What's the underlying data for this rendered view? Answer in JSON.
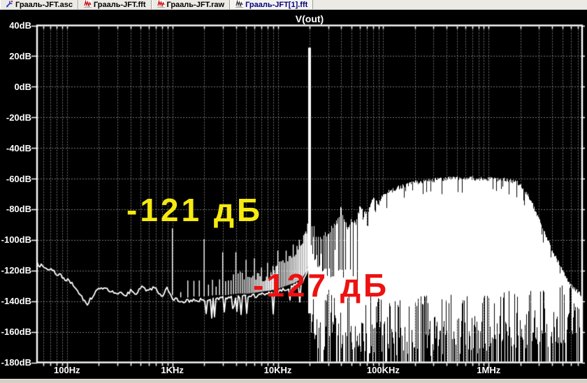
{
  "tabs": [
    {
      "label": "Грааль-JFT.asc",
      "icon": "schematic-icon",
      "active": false
    },
    {
      "label": "Грааль-JFT.fft",
      "icon": "waveform-icon",
      "active": false
    },
    {
      "label": "Грааль-JFT.raw",
      "icon": "waveform-icon",
      "active": false
    },
    {
      "label": "Грааль-JFT[1].fft",
      "icon": "waveform-gray-icon",
      "active": true
    }
  ],
  "plot": {
    "title": "V(out)",
    "y_axis": {
      "labels": [
        "40dB",
        "20dB",
        "0dB",
        "-20dB",
        "-40dB",
        "-60dB",
        "-80dB",
        "-100dB",
        "-120dB",
        "-140dB",
        "-160dB",
        "-180dB"
      ],
      "max_db": 40,
      "min_db": -180,
      "step_db": 20
    },
    "x_axis": {
      "labels": [
        {
          "text": "100Hz",
          "hz": 100
        },
        {
          "text": "1KHz",
          "hz": 1000
        },
        {
          "text": "10KHz",
          "hz": 10000
        },
        {
          "text": "100KHz",
          "hz": 100000
        },
        {
          "text": "1MHz",
          "hz": 1000000
        }
      ]
    }
  },
  "annotations": [
    {
      "text": "-121 дБ",
      "color": "#f6ea10"
    },
    {
      "text": "-127 дБ",
      "color": "#ed1111"
    }
  ],
  "colors": {
    "trace": "#ffffff",
    "grid": "#777777",
    "plot_bg": "#000000",
    "frame": "#ffffff",
    "tab_active_text": "#000080"
  },
  "chart_data": {
    "type": "line",
    "title": "V(out)",
    "x_unit": "Hz",
    "y_unit": "dB",
    "x_log": true,
    "x_range_hz": [
      52,
      7700000
    ],
    "y_range_db": [
      -180,
      40
    ],
    "grid_step_db": 20,
    "fundamental": {
      "freq_hz": 20000,
      "db": 25.5
    },
    "noise_floor": [
      [
        52,
        -115.5
      ],
      [
        66,
        -119
      ],
      [
        80,
        -122
      ],
      [
        95,
        -125
      ],
      [
        111,
        -128.5
      ],
      [
        130,
        -134
      ],
      [
        155,
        -142
      ],
      [
        181,
        -135
      ],
      [
        205,
        -131.5
      ],
      [
        228,
        -132
      ],
      [
        250,
        -132.5
      ],
      [
        276,
        -134.5
      ],
      [
        296,
        -135.5
      ],
      [
        324,
        -133.5
      ],
      [
        345,
        -135
      ],
      [
        366,
        -136
      ],
      [
        400,
        -133
      ],
      [
        430,
        -134
      ],
      [
        459,
        -134.5
      ],
      [
        490,
        -132
      ],
      [
        527,
        -130.5
      ],
      [
        560,
        -132.5
      ],
      [
        586,
        -134
      ],
      [
        620,
        -132
      ],
      [
        652,
        -131
      ],
      [
        690,
        -132
      ],
      [
        726,
        -133.5
      ],
      [
        770,
        -135
      ],
      [
        809,
        -137
      ],
      [
        850,
        -133
      ],
      [
        887,
        -130
      ],
      [
        940,
        -134
      ],
      [
        1000,
        -138
      ],
      [
        1100,
        -139
      ],
      [
        1300,
        -140
      ],
      [
        1600,
        -139
      ],
      [
        2000,
        -139
      ],
      [
        2600,
        -138
      ],
      [
        3300,
        -138
      ],
      [
        4200,
        -137
      ],
      [
        5300,
        -137
      ],
      [
        6700,
        -136
      ],
      [
        8500,
        -135
      ],
      [
        10000,
        -134
      ],
      [
        12000,
        -132
      ],
      [
        14500,
        -130
      ],
      [
        17000,
        -127
      ],
      [
        19000,
        -122
      ],
      [
        19800,
        -113
      ]
    ],
    "harmonic_peaks": [
      [
        1000,
        -92.5
      ],
      [
        2000,
        -99.5
      ],
      [
        3000,
        -108
      ],
      [
        4000,
        -108
      ],
      [
        5000,
        -113
      ],
      [
        6000,
        -112
      ],
      [
        7000,
        -118
      ],
      [
        8000,
        -115
      ],
      [
        9000,
        -117
      ],
      [
        10000,
        -107
      ],
      [
        11000,
        -108
      ],
      [
        12000,
        -107
      ],
      [
        13000,
        -105
      ],
      [
        14000,
        -103
      ],
      [
        15000,
        -102
      ],
      [
        16000,
        -100
      ],
      [
        17000,
        -98
      ],
      [
        18000,
        -96
      ],
      [
        19000,
        -90
      ]
    ],
    "sideband_envelope": [
      [
        1200,
        -133
      ],
      [
        1400,
        -126
      ],
      [
        1600,
        -127
      ],
      [
        1800,
        -128
      ],
      [
        2200,
        -127
      ],
      [
        2600,
        -129
      ],
      [
        3400,
        -124
      ],
      [
        4400,
        -123
      ],
      [
        5400,
        -125
      ],
      [
        6400,
        -124
      ],
      [
        7400,
        -126
      ],
      [
        8400,
        -122
      ],
      [
        9400,
        -121
      ],
      [
        10000,
        -117
      ],
      [
        12000,
        -113
      ],
      [
        14000,
        -110
      ],
      [
        16000,
        -104
      ],
      [
        18000,
        -98
      ],
      [
        19600,
        -90
      ]
    ],
    "upper_envelope": [
      [
        21000,
        -90
      ],
      [
        23000,
        -97
      ],
      [
        26000,
        -99
      ],
      [
        30000,
        -94
      ],
      [
        35000,
        -90
      ],
      [
        40000,
        -79
      ],
      [
        45000,
        -92
      ],
      [
        50000,
        -87
      ],
      [
        55000,
        -88
      ],
      [
        60000,
        -78
      ],
      [
        70000,
        -83
      ],
      [
        80000,
        -73
      ],
      [
        90000,
        -77
      ],
      [
        100000,
        -70
      ],
      [
        120000,
        -68
      ],
      [
        150000,
        -65
      ],
      [
        200000,
        -62.5
      ],
      [
        300000,
        -61
      ],
      [
        400000,
        -60
      ],
      [
        600000,
        -59.5
      ],
      [
        900000,
        -60
      ],
      [
        1200000,
        -60.5
      ],
      [
        1500000,
        -61
      ],
      [
        1900000,
        -63
      ],
      [
        2200000,
        -68
      ],
      [
        2600000,
        -77
      ],
      [
        3100000,
        -89
      ],
      [
        3600000,
        -100
      ],
      [
        4200000,
        -110
      ],
      [
        5000000,
        -120
      ],
      [
        6000000,
        -130
      ],
      [
        7700000,
        -137
      ]
    ],
    "skirt": [
      [
        21000,
        -106
      ],
      [
        23000,
        -113
      ],
      [
        26000,
        -118
      ],
      [
        30000,
        -121
      ],
      [
        40000,
        -123
      ],
      [
        55000,
        -124
      ],
      [
        70000,
        -122
      ],
      [
        90000,
        -118
      ],
      [
        110000,
        -112
      ],
      [
        130000,
        -104
      ],
      [
        160000,
        -90
      ],
      [
        200000,
        -75
      ],
      [
        300000,
        -63
      ]
    ],
    "mass_bottom": [
      [
        21000,
        -145
      ],
      [
        50000,
        -148
      ],
      [
        100000,
        -150
      ],
      [
        300000,
        -150
      ],
      [
        1000000,
        -148
      ],
      [
        3000000,
        -145
      ],
      [
        7700000,
        -140
      ]
    ]
  }
}
